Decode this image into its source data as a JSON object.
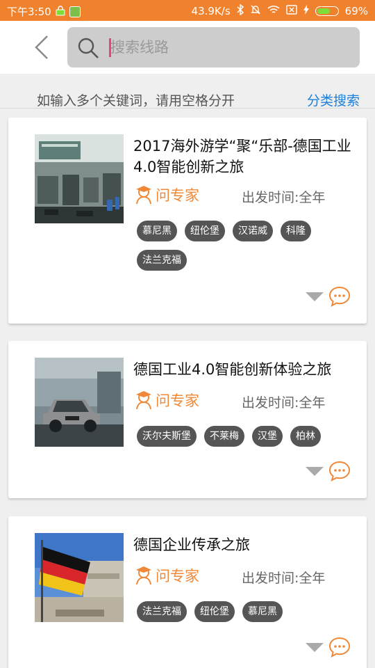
{
  "status_bar": {
    "time": "下午3:50",
    "net_speed": "43.9K/s",
    "battery": "69%",
    "battery_level": 0.69
  },
  "header": {
    "search_placeholder": "搜索线路"
  },
  "hint": {
    "text": "如输入多个关键词，请用空格分开",
    "category_link": "分类搜索"
  },
  "routes": [
    {
      "title": "2017海外游学“聚“乐部-德国工业4.0智能创新之旅",
      "ask_label": "问专家",
      "depart_label": "出发时间:全年",
      "tags": [
        "慕尼黑",
        "纽伦堡",
        "汉诺威",
        "科隆",
        "法兰克福"
      ]
    },
    {
      "title": "德国工业4.0智能创新体验之旅",
      "ask_label": "问专家",
      "depart_label": "出发时间:全年",
      "tags": [
        "沃尔夫斯堡",
        "不莱梅",
        "汉堡",
        "柏林"
      ]
    },
    {
      "title": "德国企业传承之旅",
      "ask_label": "问专家",
      "depart_label": "出发时间:全年",
      "tags": [
        "法兰克福",
        "纽伦堡",
        "慕尼黑"
      ]
    }
  ],
  "colors": {
    "status_bar": "#f0822d",
    "accent_orange": "#f08838",
    "link_blue": "#1e7fd8",
    "tag_bg": "#555555"
  }
}
